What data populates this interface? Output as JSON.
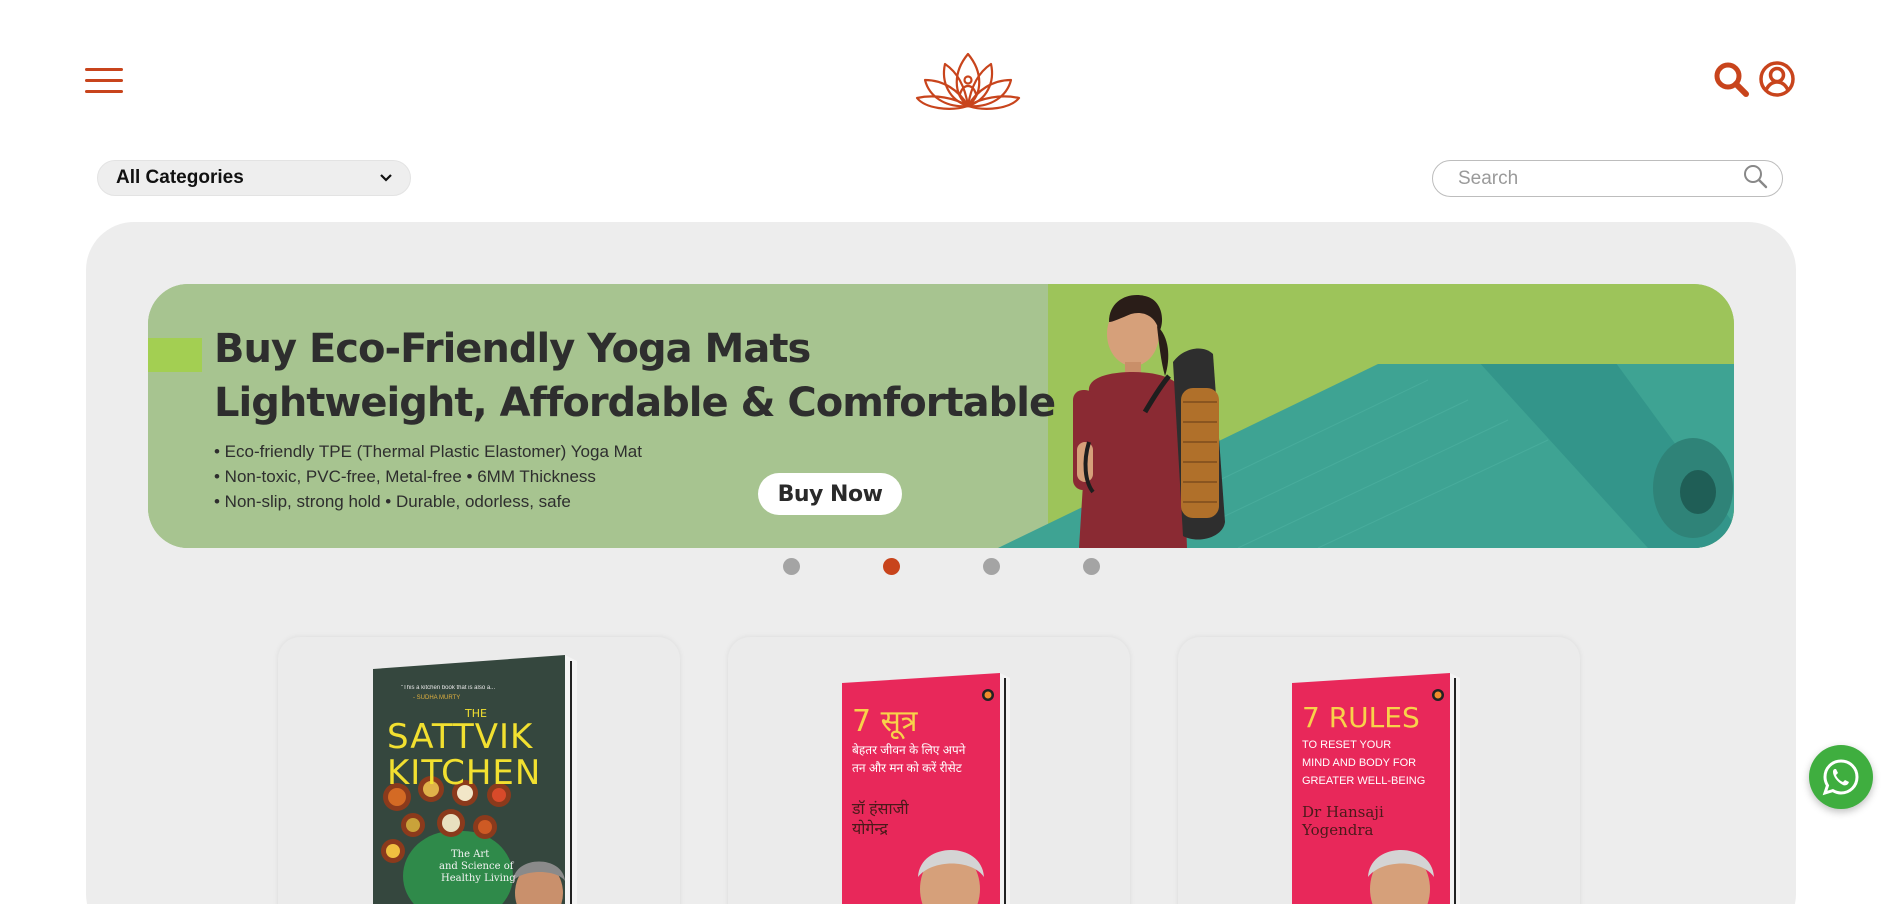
{
  "header": {
    "menu_icon": "hamburger-icon",
    "logo_icon": "lotus-logo-icon",
    "search_icon": "search-icon",
    "account_icon": "user-circle-icon",
    "accent_color": "#c8441c"
  },
  "filters": {
    "category_selected": "All Categories",
    "search_placeholder": "Search"
  },
  "banner": {
    "headline_1": "Buy Eco-Friendly Yoga Mats",
    "headline_2": "Lightweight, Affordable & Comfortable",
    "bullet_1": "• Eco-friendly TPE (Thermal Plastic Elastomer) Yoga Mat",
    "bullet_2": "• Non-toxic, PVC-free, Metal-free  • 6MM Thickness",
    "bullet_3": "• Non-slip, strong hold  • Durable, odorless, safe",
    "cta": "Buy Now",
    "background_color": "#a7c490",
    "mat_color": "#3ea393"
  },
  "carousel": {
    "slide_count": 4,
    "active_index": 1,
    "active_color": "#c8441c",
    "inactive_color": "#a4a4a4"
  },
  "products": [
    {
      "cover_color": "#35473e",
      "cover_lines": [
        "THE",
        "SATTVIK",
        "KITCHEN"
      ],
      "subtitle": [
        "The Art",
        "and Science of",
        "Healthy Living"
      ],
      "blurb": "\"This a kitchen book that is also a...",
      "blurb2": "- SUDHA MURTY"
    },
    {
      "cover_color": "#e8285a",
      "cover_lines": [
        "7 सूत्र"
      ],
      "subtitle": [
        "बेहतर जीवन के लिए अपने",
        "तन और मन को करें रीसेट"
      ],
      "author": [
        "डॉ हंसाजी",
        "योगेन्द्र"
      ]
    },
    {
      "cover_color": "#e8285a",
      "cover_lines": [
        "7 RULES"
      ],
      "subtitle": [
        "TO RESET YOUR",
        "MIND AND BODY FOR",
        "GREATER WELL-BEING"
      ],
      "author": [
        "Dr Hansaji",
        "Yogendra"
      ]
    }
  ],
  "whatsapp": {
    "icon": "whatsapp-icon",
    "color": "#3fae3f"
  }
}
